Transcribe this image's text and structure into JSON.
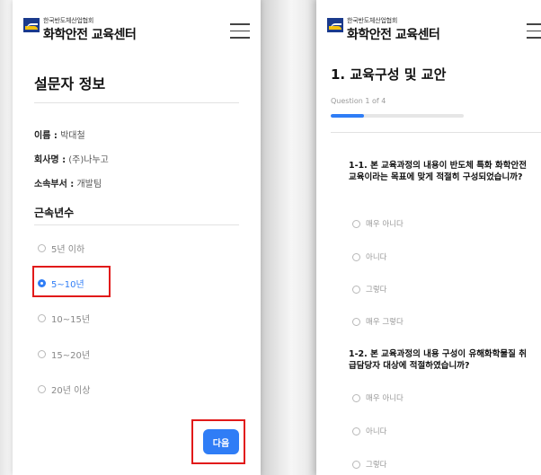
{
  "org_name": "한국반도체산업협회",
  "site_title": "화학안전 교육센터",
  "left": {
    "heading": "설문자 정보",
    "fields": [
      {
        "label": "이름 :",
        "value": "박대철"
      },
      {
        "label": "회사명 :",
        "value": "(주)나누고"
      },
      {
        "label": "소속부서 :",
        "value": "개발팀"
      }
    ],
    "tenure_title": "근속년수",
    "options": [
      "5년 이하",
      "5~10년",
      "10~15년",
      "15~20년",
      "20년 이상"
    ],
    "selected_option": "5~10년",
    "next_label": "다음"
  },
  "right": {
    "heading": "1. 교육구성 및 교안",
    "counter": "Question 1 of 4",
    "progress": 0.25,
    "questions": [
      {
        "text": "1-1. 본 교육과정의 내용이 반도체 특화 화학안전교육이라는 목표에 맞게 적절히 구성되었습니까?",
        "options": [
          "매우 아니다",
          "아니다",
          "그렇다",
          "매우 그렇다"
        ]
      },
      {
        "text": "1-2. 본 교육과정의 내용 구성이 유해화학물질 취급담당자 대상에 적절하였습니까?",
        "options": [
          "매우 아니다",
          "아니다",
          "그렇다"
        ]
      }
    ]
  },
  "colors": {
    "accent": "#2f7df6",
    "highlight": "#e11a1a",
    "logo": "#1a3a8c"
  },
  "icons": {
    "menu": "hamburger-icon",
    "radio": "radio-icon"
  }
}
